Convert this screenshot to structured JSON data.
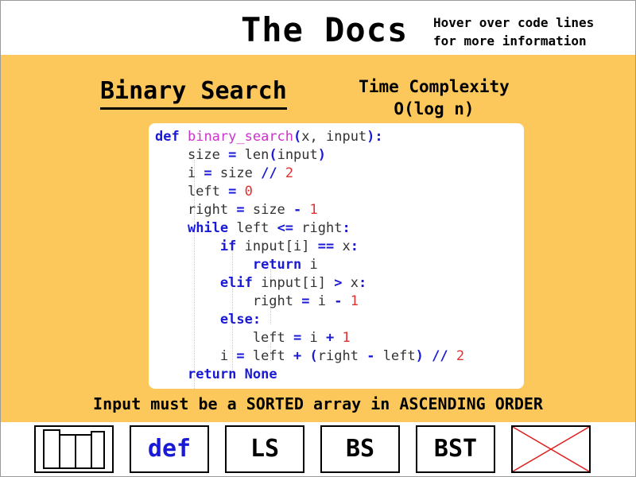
{
  "header": {
    "title": "The Docs",
    "hint_line1": "Hover over code lines",
    "hint_line2": "for more information"
  },
  "main": {
    "algorithm_title": "Binary Search",
    "complexity_label": "Time Complexity",
    "complexity_value": "O(log n)",
    "note": "Input must be a SORTED array in ASCENDING ORDER"
  },
  "code": {
    "lines": [
      "def binary_search(x, input):",
      "    size = len(input)",
      "    i = size // 2",
      "    left = 0",
      "    right = size - 1",
      "    while left <= right:",
      "        if input[i] == x:",
      "            return i",
      "        elif input[i] > x:",
      "            right = i - 1",
      "        else:",
      "            left = i + 1",
      "        i = left + (right - left) // 2",
      "    return None"
    ],
    "colors": {
      "keyword": "#1a1ad6",
      "function_name": "#cc33cc",
      "number": "#e03030",
      "text": "#333333"
    }
  },
  "nav": {
    "items": [
      {
        "label": "",
        "icon": "bar-chart-icon"
      },
      {
        "label": "def"
      },
      {
        "label": "LS"
      },
      {
        "label": "BS"
      },
      {
        "label": "BST"
      },
      {
        "label": "",
        "icon": "close-icon"
      }
    ]
  },
  "colors": {
    "background": "#fdc85b",
    "accent": "#1a1ad6",
    "close_cross": "#e02020"
  }
}
